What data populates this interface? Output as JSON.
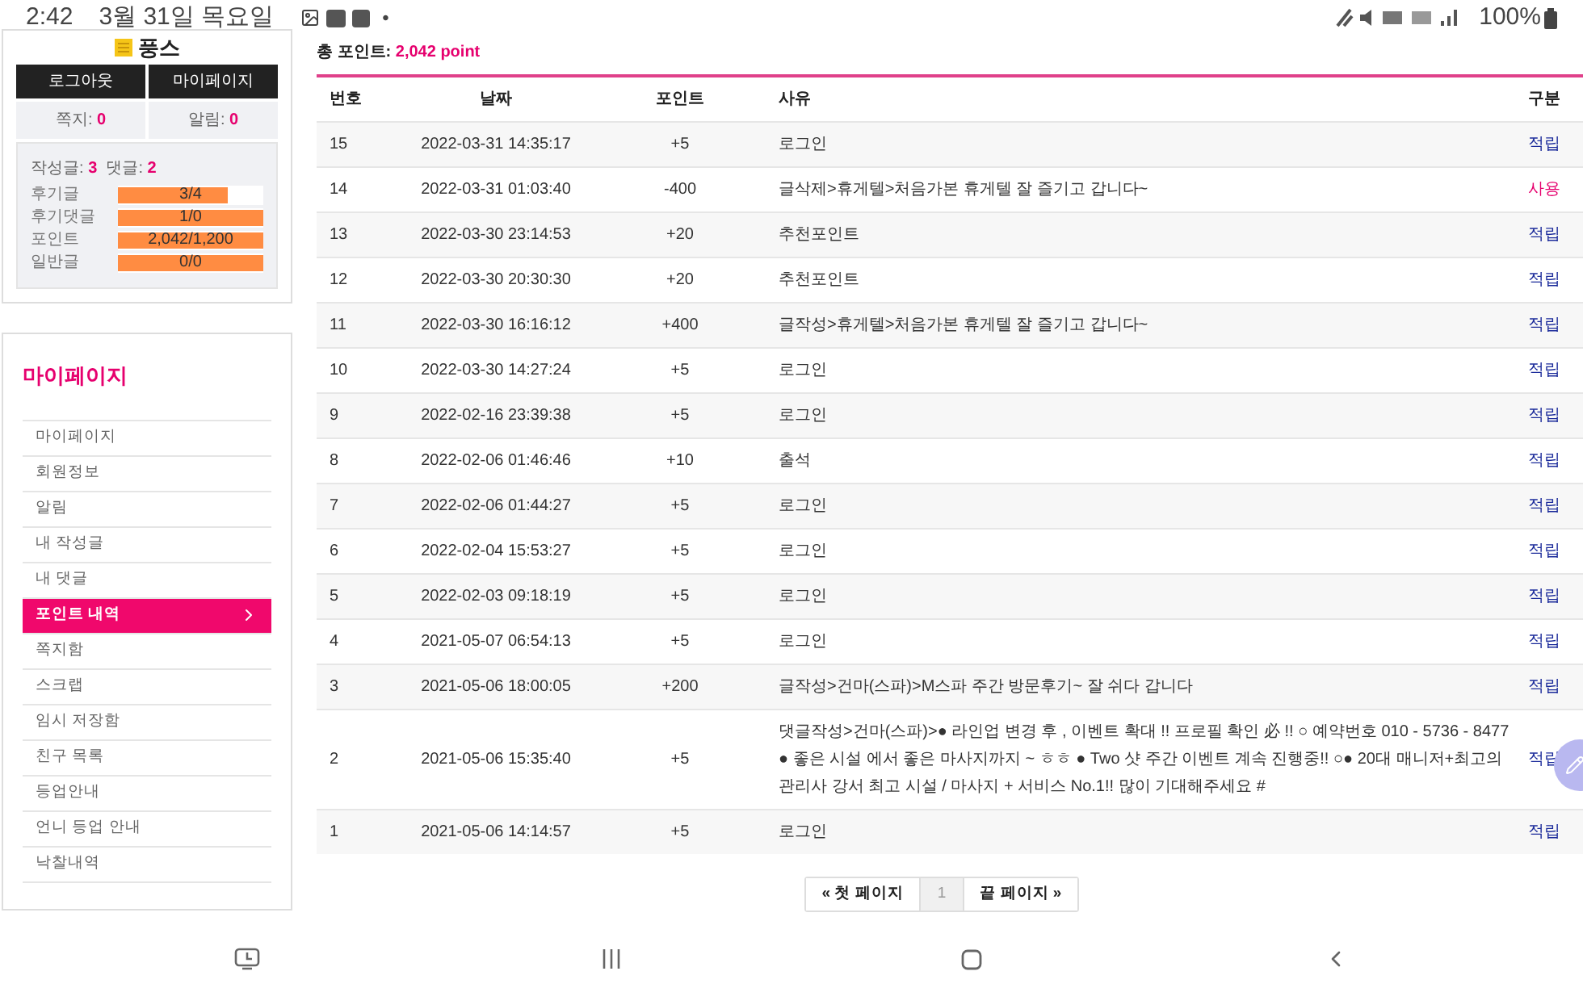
{
  "status_bar": {
    "time": "2:42",
    "date": "3월 31일 목요일",
    "dot": "•",
    "battery": "100%"
  },
  "profile": {
    "name": "풍스",
    "buttons": [
      {
        "label": "로그아웃"
      },
      {
        "label": "마이페이지"
      }
    ],
    "counts": [
      {
        "label": "쪽지:",
        "value": "0"
      },
      {
        "label": "알림:",
        "value": "0"
      }
    ],
    "posts": {
      "label": "작성글:",
      "value": "3",
      "comments_label": "댓글:",
      "comments_value": "2"
    },
    "meters": [
      {
        "label": "후기글",
        "reading": "3/4",
        "level": 0.75
      },
      {
        "label": "후기댓글",
        "reading": "1/0",
        "level": 1
      },
      {
        "label": "포인트",
        "reading": "2,042/1,200",
        "level": 1
      },
      {
        "label": "일반글",
        "reading": "0/0",
        "level": 1
      }
    ]
  },
  "sidebar": {
    "title": "마이페이지",
    "items": [
      {
        "label": "마이페이지",
        "selected": false
      },
      {
        "label": "회원정보",
        "selected": false
      },
      {
        "label": "알림",
        "selected": false
      },
      {
        "label": "내 작성글",
        "selected": false
      },
      {
        "label": "내 댓글",
        "selected": false
      },
      {
        "label": "포인트 내역",
        "selected": true
      },
      {
        "label": "쪽지함",
        "selected": false
      },
      {
        "label": "스크랩",
        "selected": false
      },
      {
        "label": "임시 저장함",
        "selected": false
      },
      {
        "label": "친구 목록",
        "selected": false
      },
      {
        "label": "등업안내",
        "selected": false
      },
      {
        "label": "언니 등업 안내",
        "selected": false
      },
      {
        "label": "낙찰내역",
        "selected": false
      }
    ]
  },
  "total": {
    "label": "총 포인트:",
    "value": "2,042 point"
  },
  "table": {
    "columns": [
      "번호",
      "날짜",
      "포인트",
      "사유",
      "구분"
    ],
    "rows": [
      {
        "no": "15",
        "date": "2022-03-31 14:35:17",
        "points": "+5",
        "reason": "로그인",
        "type": "적립",
        "kind": "earn"
      },
      {
        "no": "14",
        "date": "2022-03-31 01:03:40",
        "points": "-400",
        "reason": "글삭제>휴게텔>처음가본 휴게텔 잘 즐기고 갑니다~",
        "type": "사용",
        "kind": "use"
      },
      {
        "no": "13",
        "date": "2022-03-30 23:14:53",
        "points": "+20",
        "reason": "추천포인트",
        "type": "적립",
        "kind": "earn"
      },
      {
        "no": "12",
        "date": "2022-03-30 20:30:30",
        "points": "+20",
        "reason": "추천포인트",
        "type": "적립",
        "kind": "earn"
      },
      {
        "no": "11",
        "date": "2022-03-30 16:16:12",
        "points": "+400",
        "reason": "글작성>휴게텔>처음가본 휴게텔 잘 즐기고 갑니다~",
        "type": "적립",
        "kind": "earn"
      },
      {
        "no": "10",
        "date": "2022-03-30 14:27:24",
        "points": "+5",
        "reason": "로그인",
        "type": "적립",
        "kind": "earn"
      },
      {
        "no": "9",
        "date": "2022-02-16 23:39:38",
        "points": "+5",
        "reason": "로그인",
        "type": "적립",
        "kind": "earn"
      },
      {
        "no": "8",
        "date": "2022-02-06 01:46:46",
        "points": "+10",
        "reason": "출석",
        "type": "적립",
        "kind": "earn"
      },
      {
        "no": "7",
        "date": "2022-02-06 01:44:27",
        "points": "+5",
        "reason": "로그인",
        "type": "적립",
        "kind": "earn"
      },
      {
        "no": "6",
        "date": "2022-02-04 15:53:27",
        "points": "+5",
        "reason": "로그인",
        "type": "적립",
        "kind": "earn"
      },
      {
        "no": "5",
        "date": "2022-02-03 09:18:19",
        "points": "+5",
        "reason": "로그인",
        "type": "적립",
        "kind": "earn"
      },
      {
        "no": "4",
        "date": "2021-05-07 06:54:13",
        "points": "+5",
        "reason": "로그인",
        "type": "적립",
        "kind": "earn"
      },
      {
        "no": "3",
        "date": "2021-05-06 18:00:05",
        "points": "+200",
        "reason": "글작성>건마(스파)>M스파 주간 방문후기~ 잘 쉬다 갑니다",
        "type": "적립",
        "kind": "earn"
      },
      {
        "no": "2",
        "date": "2021-05-06 15:35:40",
        "points": "+5",
        "reason": "댓글작성>건마(스파)>● 라인업 변경 후 , 이벤트 확대 !! 프로필 확인 必 !! ○ 예약번호 010 - 5736 - 8477 ● 좋은 시설 에서 좋은 마사지까지 ~ ㅎㅎ ● Two 샷 주간 이벤트 계속 진행중!! ○● 20대 매니저+최고의관리사 강서 최고 시설 / 마사지 + 서비스 No.1!! 많이 기대해주세요 #",
        "type": "적립",
        "kind": "earn"
      },
      {
        "no": "1",
        "date": "2021-05-06 14:14:57",
        "points": "+5",
        "reason": "로그인",
        "type": "적립",
        "kind": "earn"
      }
    ]
  },
  "pagination": [
    {
      "label": "« 첫 페이지",
      "selected": false
    },
    {
      "label": "1",
      "selected": true
    },
    {
      "label": "끝 페이지 »",
      "selected": false
    }
  ]
}
